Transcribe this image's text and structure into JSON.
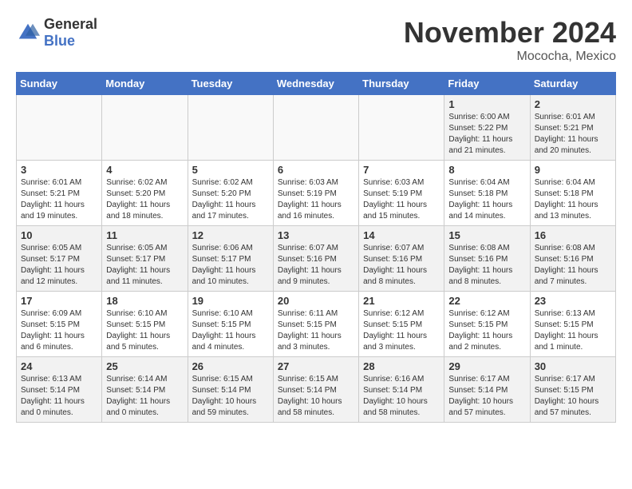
{
  "header": {
    "logo_general": "General",
    "logo_blue": "Blue",
    "month": "November 2024",
    "location": "Mococha, Mexico"
  },
  "weekdays": [
    "Sunday",
    "Monday",
    "Tuesday",
    "Wednesday",
    "Thursday",
    "Friday",
    "Saturday"
  ],
  "weeks": [
    [
      {
        "day": "",
        "info": ""
      },
      {
        "day": "",
        "info": ""
      },
      {
        "day": "",
        "info": ""
      },
      {
        "day": "",
        "info": ""
      },
      {
        "day": "",
        "info": ""
      },
      {
        "day": "1",
        "info": "Sunrise: 6:00 AM\nSunset: 5:22 PM\nDaylight: 11 hours\nand 21 minutes."
      },
      {
        "day": "2",
        "info": "Sunrise: 6:01 AM\nSunset: 5:21 PM\nDaylight: 11 hours\nand 20 minutes."
      }
    ],
    [
      {
        "day": "3",
        "info": "Sunrise: 6:01 AM\nSunset: 5:21 PM\nDaylight: 11 hours\nand 19 minutes."
      },
      {
        "day": "4",
        "info": "Sunrise: 6:02 AM\nSunset: 5:20 PM\nDaylight: 11 hours\nand 18 minutes."
      },
      {
        "day": "5",
        "info": "Sunrise: 6:02 AM\nSunset: 5:20 PM\nDaylight: 11 hours\nand 17 minutes."
      },
      {
        "day": "6",
        "info": "Sunrise: 6:03 AM\nSunset: 5:19 PM\nDaylight: 11 hours\nand 16 minutes."
      },
      {
        "day": "7",
        "info": "Sunrise: 6:03 AM\nSunset: 5:19 PM\nDaylight: 11 hours\nand 15 minutes."
      },
      {
        "day": "8",
        "info": "Sunrise: 6:04 AM\nSunset: 5:18 PM\nDaylight: 11 hours\nand 14 minutes."
      },
      {
        "day": "9",
        "info": "Sunrise: 6:04 AM\nSunset: 5:18 PM\nDaylight: 11 hours\nand 13 minutes."
      }
    ],
    [
      {
        "day": "10",
        "info": "Sunrise: 6:05 AM\nSunset: 5:17 PM\nDaylight: 11 hours\nand 12 minutes."
      },
      {
        "day": "11",
        "info": "Sunrise: 6:05 AM\nSunset: 5:17 PM\nDaylight: 11 hours\nand 11 minutes."
      },
      {
        "day": "12",
        "info": "Sunrise: 6:06 AM\nSunset: 5:17 PM\nDaylight: 11 hours\nand 10 minutes."
      },
      {
        "day": "13",
        "info": "Sunrise: 6:07 AM\nSunset: 5:16 PM\nDaylight: 11 hours\nand 9 minutes."
      },
      {
        "day": "14",
        "info": "Sunrise: 6:07 AM\nSunset: 5:16 PM\nDaylight: 11 hours\nand 8 minutes."
      },
      {
        "day": "15",
        "info": "Sunrise: 6:08 AM\nSunset: 5:16 PM\nDaylight: 11 hours\nand 8 minutes."
      },
      {
        "day": "16",
        "info": "Sunrise: 6:08 AM\nSunset: 5:16 PM\nDaylight: 11 hours\nand 7 minutes."
      }
    ],
    [
      {
        "day": "17",
        "info": "Sunrise: 6:09 AM\nSunset: 5:15 PM\nDaylight: 11 hours\nand 6 minutes."
      },
      {
        "day": "18",
        "info": "Sunrise: 6:10 AM\nSunset: 5:15 PM\nDaylight: 11 hours\nand 5 minutes."
      },
      {
        "day": "19",
        "info": "Sunrise: 6:10 AM\nSunset: 5:15 PM\nDaylight: 11 hours\nand 4 minutes."
      },
      {
        "day": "20",
        "info": "Sunrise: 6:11 AM\nSunset: 5:15 PM\nDaylight: 11 hours\nand 3 minutes."
      },
      {
        "day": "21",
        "info": "Sunrise: 6:12 AM\nSunset: 5:15 PM\nDaylight: 11 hours\nand 3 minutes."
      },
      {
        "day": "22",
        "info": "Sunrise: 6:12 AM\nSunset: 5:15 PM\nDaylight: 11 hours\nand 2 minutes."
      },
      {
        "day": "23",
        "info": "Sunrise: 6:13 AM\nSunset: 5:15 PM\nDaylight: 11 hours\nand 1 minute."
      }
    ],
    [
      {
        "day": "24",
        "info": "Sunrise: 6:13 AM\nSunset: 5:14 PM\nDaylight: 11 hours\nand 0 minutes."
      },
      {
        "day": "25",
        "info": "Sunrise: 6:14 AM\nSunset: 5:14 PM\nDaylight: 11 hours\nand 0 minutes."
      },
      {
        "day": "26",
        "info": "Sunrise: 6:15 AM\nSunset: 5:14 PM\nDaylight: 10 hours\nand 59 minutes."
      },
      {
        "day": "27",
        "info": "Sunrise: 6:15 AM\nSunset: 5:14 PM\nDaylight: 10 hours\nand 58 minutes."
      },
      {
        "day": "28",
        "info": "Sunrise: 6:16 AM\nSunset: 5:14 PM\nDaylight: 10 hours\nand 58 minutes."
      },
      {
        "day": "29",
        "info": "Sunrise: 6:17 AM\nSunset: 5:14 PM\nDaylight: 10 hours\nand 57 minutes."
      },
      {
        "day": "30",
        "info": "Sunrise: 6:17 AM\nSunset: 5:15 PM\nDaylight: 10 hours\nand 57 minutes."
      }
    ]
  ]
}
